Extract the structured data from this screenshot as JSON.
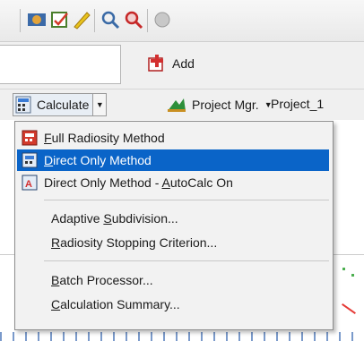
{
  "toolbar": {
    "add_label": "Add",
    "calculate_label": "Calculate",
    "project_mgr_label": "Project Mgr.",
    "project_value": "Project_1"
  },
  "menu": {
    "items": [
      {
        "label": "Full Radiosity Method",
        "accel": "F"
      },
      {
        "label": "Direct Only Method",
        "accel": "D"
      },
      {
        "label": "Direct Only Method - AutoCalc On",
        "accel": "A"
      },
      {
        "label": "Adaptive Subdivision...",
        "accel": "S"
      },
      {
        "label": "Radiosity Stopping Criterion...",
        "accel": "R"
      },
      {
        "label": "Batch Processor...",
        "accel": "B"
      },
      {
        "label": "Calculation Summary...",
        "accel": "C"
      }
    ],
    "selected_index": 1
  },
  "colors": {
    "selection": "#0a64c8",
    "menu_bg": "#f2f2f2"
  }
}
